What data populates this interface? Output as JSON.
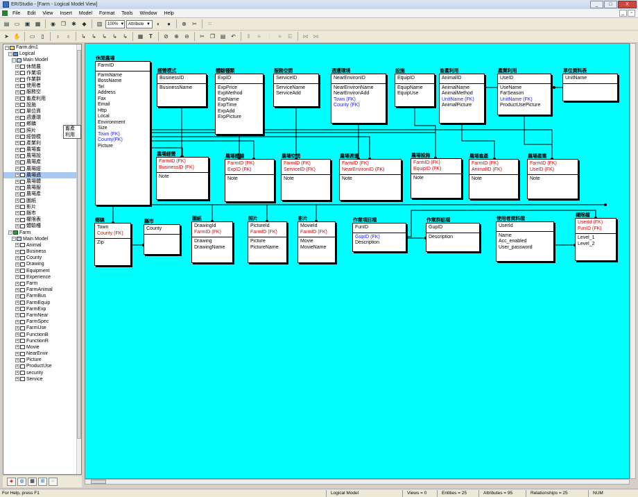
{
  "window": {
    "title": "ER/Studio - [Farm - Logical Model View]",
    "min": "_",
    "max": "□",
    "close": "X"
  },
  "menu": [
    "File",
    "Edit",
    "View",
    "Insert",
    "Model",
    "Format",
    "Tools",
    "Window",
    "Help"
  ],
  "toolbar": {
    "zoom": "100%",
    "display": "Attribute"
  },
  "tree": {
    "rows": [
      {
        "t": "Farm.dm1",
        "lvl": 0
      },
      {
        "t": "Logical",
        "lvl": 1
      },
      {
        "t": "Main Model",
        "lvl": 2
      },
      {
        "t": "休閒農",
        "lvl": 3
      },
      {
        "t": "作業項",
        "lvl": 3
      },
      {
        "t": "作業群",
        "lvl": 3
      },
      {
        "t": "使用者",
        "lvl": 3
      },
      {
        "t": "服務空",
        "lvl": 3
      },
      {
        "t": "畜產利用",
        "lvl": 3
      },
      {
        "t": "設施",
        "lvl": 3
      },
      {
        "t": "單位資",
        "lvl": 3
      },
      {
        "t": "週遭環",
        "lvl": 3
      },
      {
        "t": "鄉鎮",
        "lvl": 3
      },
      {
        "t": "照片",
        "lvl": 3
      },
      {
        "t": "經營模",
        "lvl": 3
      },
      {
        "t": "產業利",
        "lvl": 3
      },
      {
        "t": "農場畜",
        "lvl": 3
      },
      {
        "t": "農場設",
        "lvl": 3
      },
      {
        "t": "農場產",
        "lvl": 3
      },
      {
        "t": "農場經",
        "lvl": 3
      },
      {
        "t": "農場週",
        "lvl": 3
      },
      {
        "t": "農場體",
        "lvl": 3
      },
      {
        "t": "農場服",
        "lvl": 3
      },
      {
        "t": "農場產",
        "lvl": 3
      },
      {
        "t": "圖紙",
        "lvl": 3
      },
      {
        "t": "影片",
        "lvl": 3
      },
      {
        "t": "縣市",
        "lvl": 3
      },
      {
        "t": "權限表",
        "lvl": 3
      },
      {
        "t": "體驗種",
        "lvl": 3
      },
      {
        "t": "Farm",
        "lvl": 1
      },
      {
        "t": "Main Model",
        "lvl": 2
      },
      {
        "t": "Animal",
        "lvl": 3
      },
      {
        "t": "Business",
        "lvl": 3
      },
      {
        "t": "County",
        "lvl": 3
      },
      {
        "t": "Drawing",
        "lvl": 3
      },
      {
        "t": "Equipment",
        "lvl": 3
      },
      {
        "t": "Experience",
        "lvl": 3
      },
      {
        "t": "Farm",
        "lvl": 3
      },
      {
        "t": "FarmAnimal",
        "lvl": 3
      },
      {
        "t": "FarmBus",
        "lvl": 3
      },
      {
        "t": "FarmEquip",
        "lvl": 3
      },
      {
        "t": "FarmExp",
        "lvl": 3
      },
      {
        "t": "FarmNear",
        "lvl": 3
      },
      {
        "t": "FarmSpec",
        "lvl": 3
      },
      {
        "t": "FarmUse",
        "lvl": 3
      },
      {
        "t": "FunctionB",
        "lvl": 3
      },
      {
        "t": "FunctionR",
        "lvl": 3
      },
      {
        "t": "Movie",
        "lvl": 3
      },
      {
        "t": "NearEnvir",
        "lvl": 3
      },
      {
        "t": "Picture",
        "lvl": 3
      },
      {
        "t": "ProductUse",
        "lvl": 3
      },
      {
        "t": "security",
        "lvl": 3
      },
      {
        "t": "Service",
        "lvl": 3
      }
    ],
    "tooltip": "畜產利用"
  },
  "entities": [
    {
      "id": "farm",
      "name": "休閒農場",
      "pk": [
        {
          "t": "FarmID"
        }
      ],
      "at": [
        {
          "t": "FarmName"
        },
        {
          "t": "BossName"
        },
        {
          "t": "Tel"
        },
        {
          "t": "Address"
        },
        {
          "t": "Fax"
        },
        {
          "t": "Email"
        },
        {
          "t": "Http"
        },
        {
          "t": "Local"
        },
        {
          "t": "Environment"
        },
        {
          "t": "Size"
        },
        {
          "t": "Town (FK)",
          "c": "fkb"
        },
        {
          "t": "County(FK)",
          "c": "fkb"
        },
        {
          "t": "Picture"
        }
      ]
    },
    {
      "id": "bus",
      "name": "經營模式",
      "pk": [
        {
          "t": "BusinessID"
        }
      ],
      "at": [
        {
          "t": "BusinessName"
        }
      ]
    },
    {
      "id": "exp",
      "name": "體驗種類",
      "pk": [
        {
          "t": "ExpID"
        }
      ],
      "at": [
        {
          "t": "ExpPrice"
        },
        {
          "t": "ExpMethod"
        },
        {
          "t": "ExpName"
        },
        {
          "t": "ExpTime"
        },
        {
          "t": "ExpAdd"
        },
        {
          "t": "ExpPicture"
        }
      ]
    },
    {
      "id": "svc",
      "name": "服務空間",
      "pk": [
        {
          "t": "ServiceID"
        }
      ],
      "at": [
        {
          "t": "ServiceName"
        },
        {
          "t": "ServiceAdd"
        }
      ]
    },
    {
      "id": "near",
      "name": "週遭環境",
      "pk": [
        {
          "t": "NearEnvironID"
        }
      ],
      "at": [
        {
          "t": "NearEnvironName"
        },
        {
          "t": "NearEnvironAdd"
        },
        {
          "t": "Town (FK)",
          "c": "fkb"
        },
        {
          "t": "County (FK)",
          "c": "fkb"
        }
      ]
    },
    {
      "id": "equip",
      "name": "設施",
      "pk": [
        {
          "t": "EquipID"
        }
      ],
      "at": [
        {
          "t": "EquipName"
        },
        {
          "t": "EquipUse"
        }
      ]
    },
    {
      "id": "animal",
      "name": "畜產利用",
      "pk": [
        {
          "t": "AnimalID"
        }
      ],
      "at": [
        {
          "t": "AnimalName"
        },
        {
          "t": "AnimalMethod"
        },
        {
          "t": "UnitName (FK)",
          "c": "fkb"
        },
        {
          "t": "AnimalPicture"
        }
      ]
    },
    {
      "id": "use",
      "name": "產業利用",
      "pk": [
        {
          "t": "UseID"
        }
      ],
      "at": [
        {
          "t": "UseName"
        },
        {
          "t": "FarSeason"
        },
        {
          "t": "UnitName (FK)",
          "c": "fkb"
        },
        {
          "t": "ProductUsePicture"
        }
      ]
    },
    {
      "id": "unit",
      "name": "單位資料表",
      "pk": [
        {
          "t": "UnitName"
        }
      ],
      "at": []
    },
    {
      "id": "fbus",
      "name": "農場經營",
      "pk": [
        {
          "t": "FarmID (FK)",
          "c": "fk"
        },
        {
          "t": "BusinessID (FK)",
          "c": "fk"
        }
      ],
      "at": [
        {
          "t": "Note"
        }
      ]
    },
    {
      "id": "fexp",
      "name": "農場體驗",
      "pk": [
        {
          "t": "FarmID (FK)",
          "c": "fk"
        },
        {
          "t": "ExpID (FK)",
          "c": "fk"
        }
      ],
      "at": [
        {
          "t": "Note"
        }
      ]
    },
    {
      "id": "fsvc",
      "name": "農場空間",
      "pk": [
        {
          "t": "FarmID (FK)",
          "c": "fk"
        },
        {
          "t": "ServiceID (FK)",
          "c": "fk"
        }
      ],
      "at": [
        {
          "t": "Note"
        }
      ]
    },
    {
      "id": "fnear",
      "name": "農場週遭",
      "pk": [
        {
          "t": "FarmID (FK)",
          "c": "fk"
        },
        {
          "t": "NearEnvironID (FK)",
          "c": "fk"
        }
      ],
      "at": [
        {
          "t": "Note"
        }
      ]
    },
    {
      "id": "fequip",
      "name": "農場設施",
      "pk": [
        {
          "t": "FarmID (FK)",
          "c": "fk"
        },
        {
          "t": "EquipID (FK)",
          "c": "fk"
        }
      ],
      "at": [
        {
          "t": "Note"
        }
      ]
    },
    {
      "id": "fanimal",
      "name": "農場畜產",
      "pk": [
        {
          "t": "FarmID (FK)",
          "c": "fk"
        },
        {
          "t": "AnimalID (FK)",
          "c": "fk"
        }
      ],
      "at": [
        {
          "t": "Note"
        }
      ]
    },
    {
      "id": "fuse",
      "name": "農場產業",
      "pk": [
        {
          "t": "FarmID (FK)",
          "c": "fk"
        },
        {
          "t": "UseID (FK)",
          "c": "fk"
        }
      ],
      "at": [
        {
          "t": "Note"
        }
      ]
    },
    {
      "id": "town",
      "name": "鄉鎮",
      "pk": [
        {
          "t": "Town"
        },
        {
          "t": "County (FK)",
          "c": "fk"
        }
      ],
      "at": [
        {
          "t": "Zip"
        }
      ]
    },
    {
      "id": "county",
      "name": "縣市",
      "pk": [
        {
          "t": "County"
        }
      ],
      "at": []
    },
    {
      "id": "draw",
      "name": "圖紙",
      "pk": [
        {
          "t": "DrawingId"
        },
        {
          "t": "FarmID (FK)",
          "c": "fk"
        }
      ],
      "at": [
        {
          "t": "Drawing"
        },
        {
          "t": "DrawingName"
        }
      ]
    },
    {
      "id": "pic",
      "name": "照片",
      "pk": [
        {
          "t": "PictureId"
        },
        {
          "t": "FarmID (FK)",
          "c": "fk"
        }
      ],
      "at": [
        {
          "t": "Picture"
        },
        {
          "t": "PictureName"
        }
      ]
    },
    {
      "id": "movie",
      "name": "影片",
      "pk": [
        {
          "t": "MovieId"
        },
        {
          "t": "FarmID (FK)",
          "c": "fk"
        }
      ],
      "at": [
        {
          "t": "Movie"
        },
        {
          "t": "MovieName"
        }
      ]
    },
    {
      "id": "fitem",
      "name": "作業項目檔",
      "pk": [
        {
          "t": "FunID"
        }
      ],
      "at": [
        {
          "t": "GupID (FK)",
          "c": "fkb"
        },
        {
          "t": "Description"
        }
      ]
    },
    {
      "id": "fgroup",
      "name": "作業群組檔",
      "pk": [
        {
          "t": "GupID"
        }
      ],
      "at": [
        {
          "t": "Description"
        }
      ]
    },
    {
      "id": "user",
      "name": "使用者資料檔",
      "pk": [
        {
          "t": "UserId"
        }
      ],
      "at": [
        {
          "t": "Name"
        },
        {
          "t": "Acc_enabled"
        },
        {
          "t": "User_password"
        }
      ]
    },
    {
      "id": "perm",
      "name": "權限檔",
      "pk": [
        {
          "t": "UserId (FK)",
          "c": "fk"
        },
        {
          "t": "FunID (FK)",
          "c": "fk"
        }
      ],
      "at": [
        {
          "t": "Level_1"
        },
        {
          "t": "Level_2"
        }
      ]
    }
  ],
  "status": {
    "help": "For Help, press F1",
    "model": "Logical Model",
    "views": "Views = 0",
    "entities": "Entities = 25",
    "attributes": "Attributes = 95",
    "relationships": "Relationships = 25",
    "num": "NUM"
  }
}
